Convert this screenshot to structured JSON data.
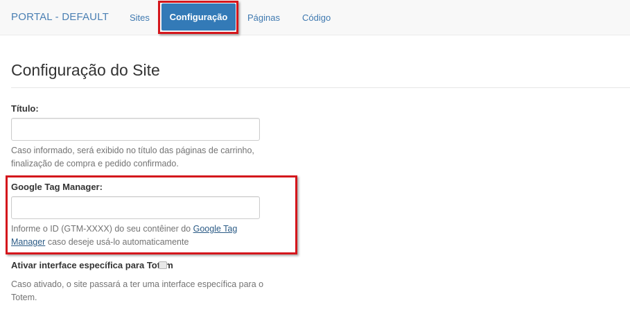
{
  "navbar": {
    "brand": "PORTAL - DEFAULT",
    "items": [
      {
        "label": "Sites"
      },
      {
        "label": "Configuração",
        "active": true
      },
      {
        "label": "Páginas"
      },
      {
        "label": "Código"
      }
    ]
  },
  "page": {
    "title": "Configuração do Site"
  },
  "form": {
    "titulo": {
      "label": "Título:",
      "value": "",
      "help": "Caso informado, será exibido no título das páginas de carrinho, finalização de compra e pedido confirmado."
    },
    "gtm": {
      "label": "Google Tag Manager:",
      "value": "",
      "help_prefix": "Informe o ID (GTM-XXXX) do seu contêiner do ",
      "help_link": "Google Tag Manager",
      "help_suffix": " caso deseje usá-lo automaticamente"
    },
    "totem": {
      "label": "Ativar interface específica para Totem",
      "checked": false,
      "help": "Caso ativado, o site passará a ter uma interface específica para o Totem."
    }
  },
  "colors": {
    "accent": "#337ab7",
    "highlight": "#d4161c",
    "link": "#3f79b0"
  }
}
